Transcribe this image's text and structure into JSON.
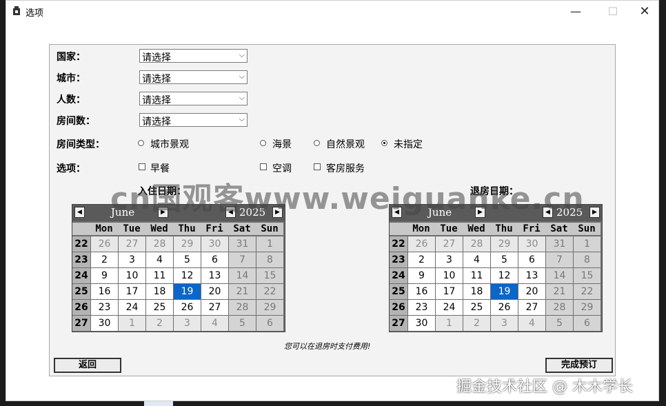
{
  "window": {
    "title": "选项",
    "minimize": "—",
    "maximize": "☐",
    "close": "✕"
  },
  "form": {
    "country": {
      "label": "国家：",
      "value": "请选择"
    },
    "city": {
      "label": "城市：",
      "value": "请选择"
    },
    "people": {
      "label": "人数：",
      "value": "请选择"
    },
    "rooms": {
      "label": "房间数：",
      "value": "请选择"
    },
    "room_type": {
      "label": "房间类型：",
      "options": [
        "城市景观",
        "海景",
        "自然景观",
        "未指定"
      ],
      "selected": "未指定"
    },
    "extras": {
      "label": "选项：",
      "options": [
        "早餐",
        "空调",
        "客房服务"
      ]
    },
    "checkin_label": "入住日期：",
    "checkout_label": "退房日期："
  },
  "calendar_left": {
    "month": "June",
    "year": "2025",
    "selected_day": "19"
  },
  "calendar_right": {
    "month": "June",
    "year": "2025",
    "selected_day": "19"
  },
  "calendar_common": {
    "weekdays": [
      "Mon",
      "Tue",
      "Wed",
      "Thu",
      "Fri",
      "Sat",
      "Sun"
    ],
    "weeks": [
      "22",
      "23",
      "24",
      "25",
      "26",
      "27"
    ],
    "days": [
      [
        "26",
        "27",
        "28",
        "29",
        "30",
        "31",
        "1"
      ],
      [
        "2",
        "3",
        "4",
        "5",
        "6",
        "7",
        "8"
      ],
      [
        "9",
        "10",
        "11",
        "12",
        "13",
        "14",
        "15"
      ],
      [
        "16",
        "17",
        "18",
        "19",
        "20",
        "21",
        "22"
      ],
      [
        "23",
        "24",
        "25",
        "26",
        "27",
        "28",
        "29"
      ],
      [
        "30",
        "1",
        "2",
        "3",
        "4",
        "5",
        "6"
      ]
    ]
  },
  "note": "您可以在退房时支付费用!",
  "buttons": {
    "back": "返回",
    "finish": "完成预订"
  },
  "watermark": "cn国观客www.weiguanke.cn",
  "footer_watermark": "掘金技术社区 @ 木木学长"
}
